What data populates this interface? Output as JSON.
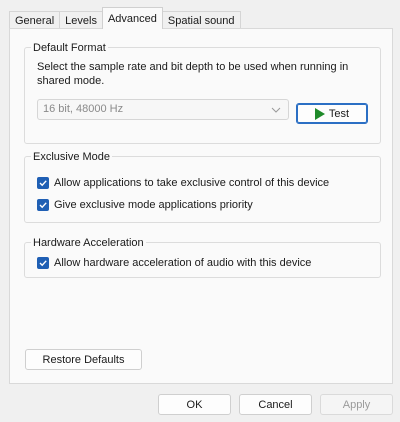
{
  "tabs": [
    "General",
    "Levels",
    "Advanced",
    "Spatial sound"
  ],
  "active_tab": "Advanced",
  "default_format": {
    "title": "Default Format",
    "description": "Select the sample rate and bit depth to be used when running in shared mode.",
    "selected_format": "16 bit, 48000 Hz",
    "test_label": "Test"
  },
  "exclusive_mode": {
    "title": "Exclusive Mode",
    "allow_exclusive": {
      "label": "Allow applications to take exclusive control of this device",
      "checked": true
    },
    "give_priority": {
      "label": "Give exclusive mode applications priority",
      "checked": true
    }
  },
  "hardware_acceleration": {
    "title": "Hardware Acceleration",
    "allow_hw": {
      "label": "Allow hardware acceleration of audio with this device",
      "checked": true
    }
  },
  "restore_defaults_label": "Restore Defaults",
  "footer": {
    "ok_label": "OK",
    "cancel_label": "Cancel",
    "apply_label": "Apply"
  },
  "colors": {
    "accent": "#1f5fb4",
    "play_green": "#1f8a2a"
  },
  "icons": {
    "play": "play-icon",
    "checkmark": "checkmark-icon",
    "dropdown": "chevron-down-icon"
  }
}
